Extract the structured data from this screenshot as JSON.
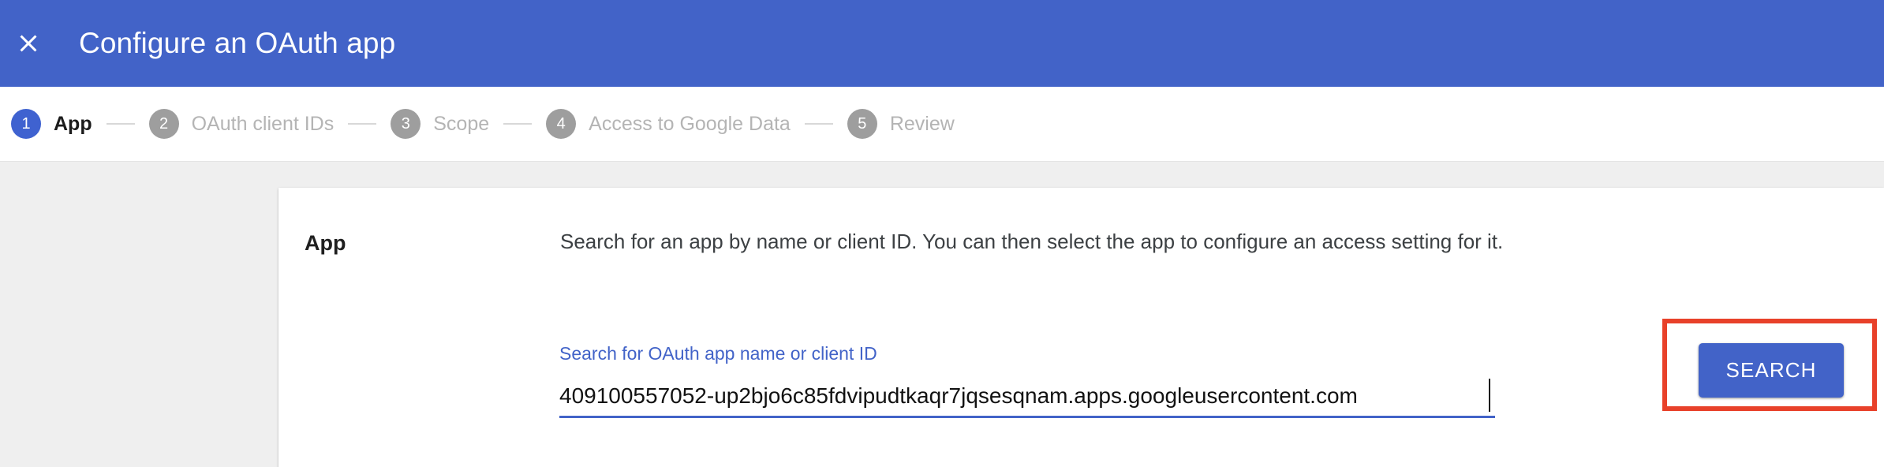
{
  "header": {
    "title": "Configure an OAuth app",
    "close_icon": "close-icon",
    "background_color": "#4263c8"
  },
  "stepper": {
    "steps": [
      {
        "number": "1",
        "label": "App",
        "state": "active"
      },
      {
        "number": "2",
        "label": "OAuth client IDs",
        "state": "inactive"
      },
      {
        "number": "3",
        "label": "Scope",
        "state": "inactive"
      },
      {
        "number": "4",
        "label": "Access to Google Data",
        "state": "inactive"
      },
      {
        "number": "5",
        "label": "Review",
        "state": "inactive"
      }
    ],
    "active_color": "#3f62d0",
    "inactive_color": "#9e9e9e"
  },
  "main": {
    "section_title": "App",
    "section_description": "Search for an app by name or client ID. You can then select the app to configure an access setting for it.",
    "search_field": {
      "label": "Search for OAuth app name or client ID",
      "value": "409100557052-up2bjo6c85fdvipudtkaqr7jqsesqnam.apps.googleusercontent.com",
      "placeholder": "Search for OAuth app name or client ID",
      "underline_color": "#4263c8",
      "has_caret": true
    },
    "search_button": {
      "label": "SEARCH",
      "color": "#4263c8"
    },
    "highlight": {
      "color": "#e8412a"
    }
  }
}
